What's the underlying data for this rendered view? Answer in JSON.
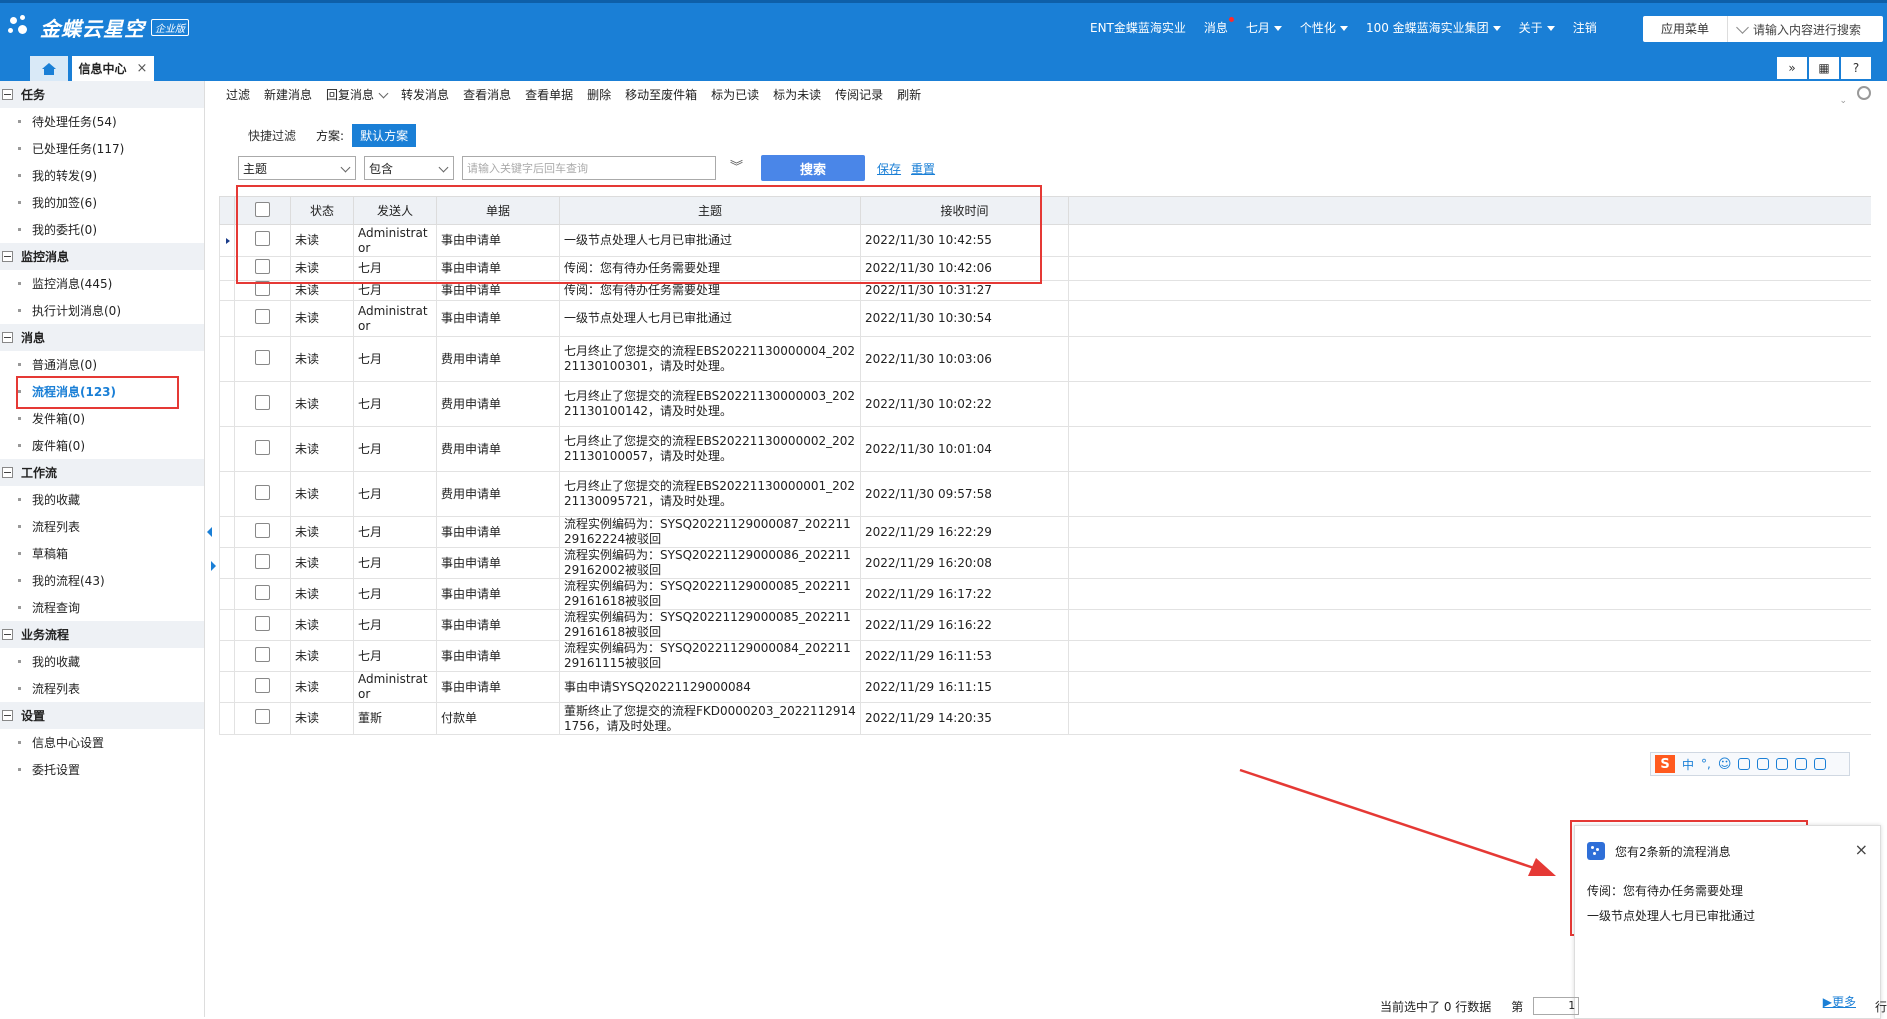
{
  "header": {
    "brand": "金蝶云星空",
    "edition": "企业版",
    "nav": [
      {
        "label": "ENT金蝶蓝海实业",
        "caret": false,
        "dot": false
      },
      {
        "label": "消息",
        "caret": false,
        "dot": true
      },
      {
        "label": "七月",
        "caret": true,
        "dot": false
      },
      {
        "label": "个性化",
        "caret": true,
        "dot": false
      },
      {
        "label": "100  金蝶蓝海实业集团",
        "caret": true,
        "dot": false
      },
      {
        "label": "关于",
        "caret": true,
        "dot": false
      },
      {
        "label": "注销",
        "caret": false,
        "dot": false
      }
    ],
    "app_menu": "应用菜单",
    "search_placeholder": "请输入内容进行搜索"
  },
  "tabs": {
    "active_label": "信息中心",
    "close": "×"
  },
  "tabbar_right": [
    "»",
    "▦",
    "?"
  ],
  "sidebar": [
    {
      "group": "任务",
      "items": [
        {
          "label": "待处理任务(54)"
        },
        {
          "label": "已处理任务(117)"
        },
        {
          "label": "我的转发(9)"
        },
        {
          "label": "我的加签(6)"
        },
        {
          "label": "我的委托(0)"
        }
      ]
    },
    {
      "group": "监控消息",
      "items": [
        {
          "label": "监控消息(445)"
        },
        {
          "label": "执行计划消息(0)"
        }
      ]
    },
    {
      "group": "消息",
      "items": [
        {
          "label": "普通消息(0)"
        },
        {
          "label": "流程消息(123)",
          "active": true
        },
        {
          "label": "发件箱(0)"
        },
        {
          "label": "废件箱(0)"
        }
      ]
    },
    {
      "group": "工作流",
      "items": [
        {
          "label": "我的收藏"
        },
        {
          "label": "流程列表"
        },
        {
          "label": "草稿箱"
        },
        {
          "label": "我的流程(43)"
        },
        {
          "label": "流程查询"
        }
      ]
    },
    {
      "group": "业务流程",
      "items": [
        {
          "label": "我的收藏"
        },
        {
          "label": "流程列表"
        }
      ]
    },
    {
      "group": "设置",
      "items": [
        {
          "label": "信息中心设置"
        },
        {
          "label": "委托设置"
        }
      ]
    }
  ],
  "toolbar": [
    {
      "label": "过滤"
    },
    {
      "label": "新建消息"
    },
    {
      "label": "回复消息",
      "dropdown": true
    },
    {
      "label": "转发消息"
    },
    {
      "label": "查看消息"
    },
    {
      "label": "查看单据"
    },
    {
      "label": "删除"
    },
    {
      "label": "移动至废件箱"
    },
    {
      "label": "标为已读"
    },
    {
      "label": "标为未读"
    },
    {
      "label": "传阅记录"
    },
    {
      "label": "刷新"
    }
  ],
  "filter": {
    "quick_label": "快捷过滤",
    "plan_label": "方案:",
    "plan_value": "默认方案",
    "field": "主题",
    "operator": "包含",
    "keyword_placeholder": "请输入关键字后回车查询",
    "expand": "︾",
    "search": "搜索",
    "save": "保存",
    "reset": "重置"
  },
  "table": {
    "headers": [
      "状态",
      "发送人",
      "单据",
      "主题",
      "接收时间"
    ],
    "rows": [
      {
        "status": "未读",
        "sender": "Administrator",
        "doc": "事由申请单",
        "subject": "一级节点处理人七月已审批通过",
        "time": "2022/11/30 10:42:55"
      },
      {
        "status": "未读",
        "sender": "七月",
        "doc": "事由申请单",
        "subject": "传阅：您有待办任务需要处理",
        "time": "2022/11/30 10:42:06"
      },
      {
        "status": "未读",
        "sender": "七月",
        "doc": "事由申请单",
        "subject": "传阅：您有待办任务需要处理",
        "time": "2022/11/30 10:31:27"
      },
      {
        "status": "未读",
        "sender": "Administrator",
        "doc": "事由申请单",
        "subject": "一级节点处理人七月已审批通过",
        "time": "2022/11/30 10:30:54"
      },
      {
        "status": "未读",
        "sender": "七月",
        "doc": "费用申请单",
        "subject": "七月终止了您提交的流程EBS20221130000004_20221130100301，请及时处理。",
        "time": "2022/11/30 10:03:06"
      },
      {
        "status": "未读",
        "sender": "七月",
        "doc": "费用申请单",
        "subject": "七月终止了您提交的流程EBS20221130000003_20221130100142，请及时处理。",
        "time": "2022/11/30 10:02:22"
      },
      {
        "status": "未读",
        "sender": "七月",
        "doc": "费用申请单",
        "subject": "七月终止了您提交的流程EBS20221130000002_20221130100057，请及时处理。",
        "time": "2022/11/30 10:01:04"
      },
      {
        "status": "未读",
        "sender": "七月",
        "doc": "费用申请单",
        "subject": "七月终止了您提交的流程EBS20221130000001_20221130095721，请及时处理。",
        "time": "2022/11/30 09:57:58"
      },
      {
        "status": "未读",
        "sender": "七月",
        "doc": "事由申请单",
        "subject": "流程实例编码为：SYSQ20221129000087_20221129162224被驳回",
        "time": "2022/11/29 16:22:29"
      },
      {
        "status": "未读",
        "sender": "七月",
        "doc": "事由申请单",
        "subject": "流程实例编码为：SYSQ20221129000086_20221129162002被驳回",
        "time": "2022/11/29 16:20:08"
      },
      {
        "status": "未读",
        "sender": "七月",
        "doc": "事由申请单",
        "subject": "流程实例编码为：SYSQ20221129000085_20221129161618被驳回",
        "time": "2022/11/29 16:17:22"
      },
      {
        "status": "未读",
        "sender": "七月",
        "doc": "事由申请单",
        "subject": "流程实例编码为：SYSQ20221129000085_20221129161618被驳回",
        "time": "2022/11/29 16:16:22"
      },
      {
        "status": "未读",
        "sender": "七月",
        "doc": "事由申请单",
        "subject": "流程实例编码为：SYSQ20221129000084_20221129161115被驳回",
        "time": "2022/11/29 16:11:53"
      },
      {
        "status": "未读",
        "sender": "Administrator",
        "doc": "事由申请单",
        "subject": "事由申请SYSQ20221129000084",
        "time": "2022/11/29 16:11:15"
      },
      {
        "status": "未读",
        "sender": "董斯",
        "doc": "付款单",
        "subject": "董斯终止了您提交的流程FKD0000203_20221129141756，请及时处理。",
        "time": "2022/11/29 14:20:35"
      }
    ]
  },
  "ime": {
    "logo": "S",
    "lang": "中",
    "punct": "°,"
  },
  "popup": {
    "title": "您有2条新的流程消息",
    "lines": [
      "传阅：您有待办任务需要处理",
      "一级节点处理人七月已审批通过"
    ],
    "close": "×",
    "more": "▶更多"
  },
  "footer": {
    "selected": "当前选中了 0 行数据",
    "page_label": "第",
    "page_value": "1",
    "row_suffix": "行"
  },
  "colors": {
    "primary": "#1a7fd6",
    "highlight": "#e53935",
    "search_button": "#4a86e8"
  }
}
